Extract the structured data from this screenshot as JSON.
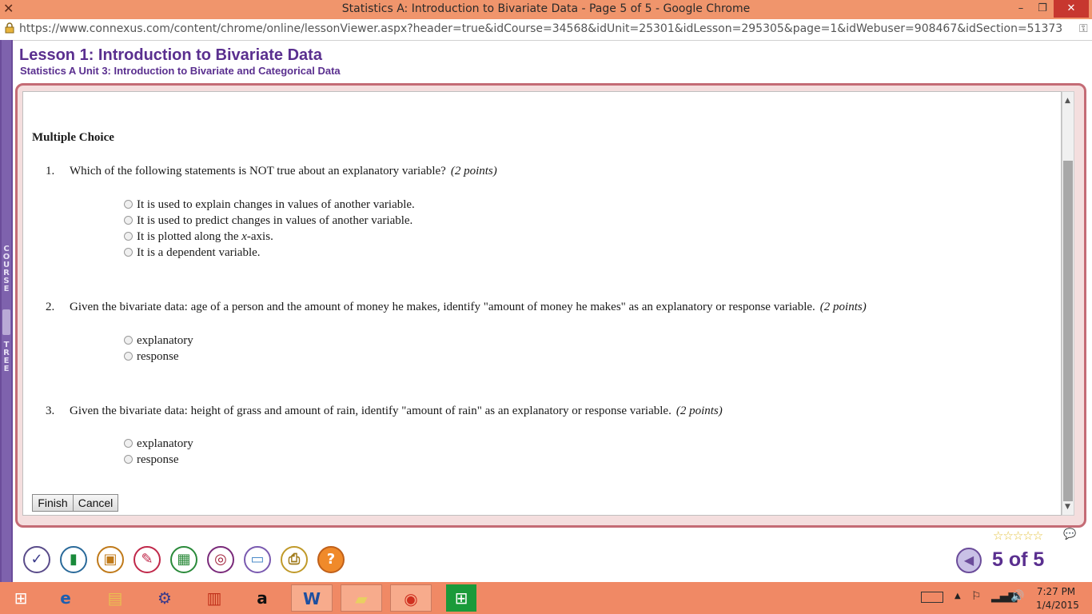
{
  "window": {
    "title": "Statistics A: Introduction to Bivariate Data - Page 5 of 5 - Google Chrome",
    "minimize_glyph": "–",
    "maximize_glyph": "❐",
    "close_glyph": "✕"
  },
  "browser": {
    "url": "https://www.connexus.com/content/chrome/online/lessonViewer.aspx?header=true&idCourse=34568&idUnit=25301&idLesson=295305&page=1&idWebuser=908467&idSection=51373",
    "lock_icon": "lock-icon",
    "key_icon": "key-icon"
  },
  "sidebar": {
    "course_tree_letters": "COURSE TREE"
  },
  "lesson": {
    "title": "Lesson 1: Introduction to Bivariate Data",
    "subtitle": "Statistics A  Unit 3: Introduction to Bivariate and Categorical Data"
  },
  "quiz": {
    "heading": "Multiple Choice",
    "questions": [
      {
        "number": "1.",
        "text": "Which of the following statements is NOT true about an explanatory variable?",
        "points": "(2 points)",
        "options": [
          "It is used to explain changes in values of another variable.",
          "It is used to predict changes in values of another variable.",
          "It is plotted along the x-axis.",
          "It is a dependent variable."
        ]
      },
      {
        "number": "2.",
        "text": "Given the bivariate data: age of a person and the amount of money he makes, identify \"amount of money he makes\" as an explanatory or response variable.",
        "points": "(2 points)",
        "options": [
          "explanatory",
          "response"
        ]
      },
      {
        "number": "3.",
        "text": "Given the bivariate data: height of grass and amount of rain, identify \"amount of rain\" as an explanatory or response variable.",
        "points": "(2 points)",
        "options": [
          "explanatory",
          "response"
        ]
      }
    ],
    "finish_label": "Finish",
    "cancel_label": "Cancel"
  },
  "toolbar": {
    "tools": [
      "check-icon",
      "book-icon",
      "backpack-icon",
      "pushpin-icon",
      "calculator-icon",
      "target-icon",
      "whiteboard-icon",
      "printer-icon",
      "help-icon"
    ],
    "rating_stars": "☆☆☆☆☆",
    "pager_text": "5 of 5"
  },
  "taskbar": {
    "apps": [
      "start-icon",
      "internet-explorer-icon",
      "file-explorer-icon",
      "media-icon",
      "toolbox-icon",
      "amazon-icon",
      "word-icon",
      "sticky-notes-icon",
      "chrome-icon",
      "store-icon"
    ],
    "clock_time": "7:27 PM",
    "clock_date": "1/4/2015"
  }
}
